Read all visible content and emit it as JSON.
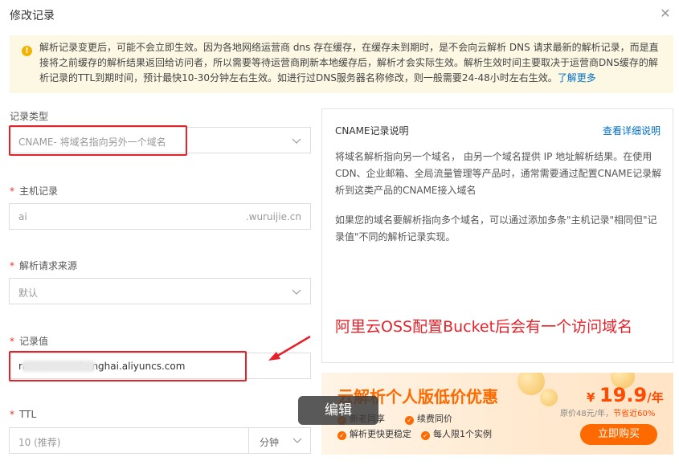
{
  "dialog": {
    "title": "修改记录"
  },
  "notice": {
    "text": "解析记录变更后，可能不会立即生效。因为各地网络运营商 dns 存在缓存，在缓存未到期时，是不会向云解析 DNS 请求最新的解析记录，而是直接将之前缓存的解析结果返回给访问者，所以需要等待运营商刷新本地缓存后，解析才会实际生效。解析生效时间主要取决于运营商DNS缓存的解析记录的TTL到期时间，预计最快10-30分钟左右生效。如进行过DNS服务器名称修改，则一般需要24-48小时左右生效。",
    "link": "了解更多"
  },
  "form": {
    "record_type": {
      "label": "记录类型",
      "value": "CNAME- 将域名指向另外一个域名"
    },
    "host": {
      "label": "主机记录",
      "value": "ai",
      "suffix": ".wuruijie.cn"
    },
    "source": {
      "label": "解析请求来源",
      "value": "默认"
    },
    "record_value": {
      "label": "记录值",
      "value": "ra                    n.oss-cn-shanghai.aliyuncs.com"
    },
    "ttl": {
      "label": "TTL",
      "value": "10 (推荐)",
      "unit": "分钟"
    }
  },
  "info_panel": {
    "heading": "CNAME记录说明",
    "link": "查看详细说明",
    "para1": "将域名解析指向另一个域名， 由另一个域名提供 IP 地址解析结果。在使用CDN、企业邮箱、全局流量管理等产品时，通常需要通过配置CNAME记录解析到这类产品的CNAME接入域名",
    "para2": "如果您的域名要解析指向多个域名，可以通过添加多条\"主机记录\"相同但\"记录值\"不同的解析记录实现。",
    "annotation": "阿里云OSS配置Bucket后会有一个访问域名"
  },
  "promo": {
    "headline": "云解析个人版低价优惠",
    "features": [
      "新老同享",
      "续费同价",
      "解析更快更稳定",
      "每人限1个实例"
    ],
    "price_currency": "¥",
    "price_value": "19.9",
    "price_unit": "/年",
    "original_price": "原价48元/年，",
    "saving": "节省近60%",
    "buy": "立即购买"
  },
  "tooltip": {
    "text": "编辑"
  },
  "colors": {
    "accent": "#0070cc",
    "annotation": "#e5222a",
    "promo": "#ff6a00",
    "notice_bg": "#fdf8e4"
  }
}
